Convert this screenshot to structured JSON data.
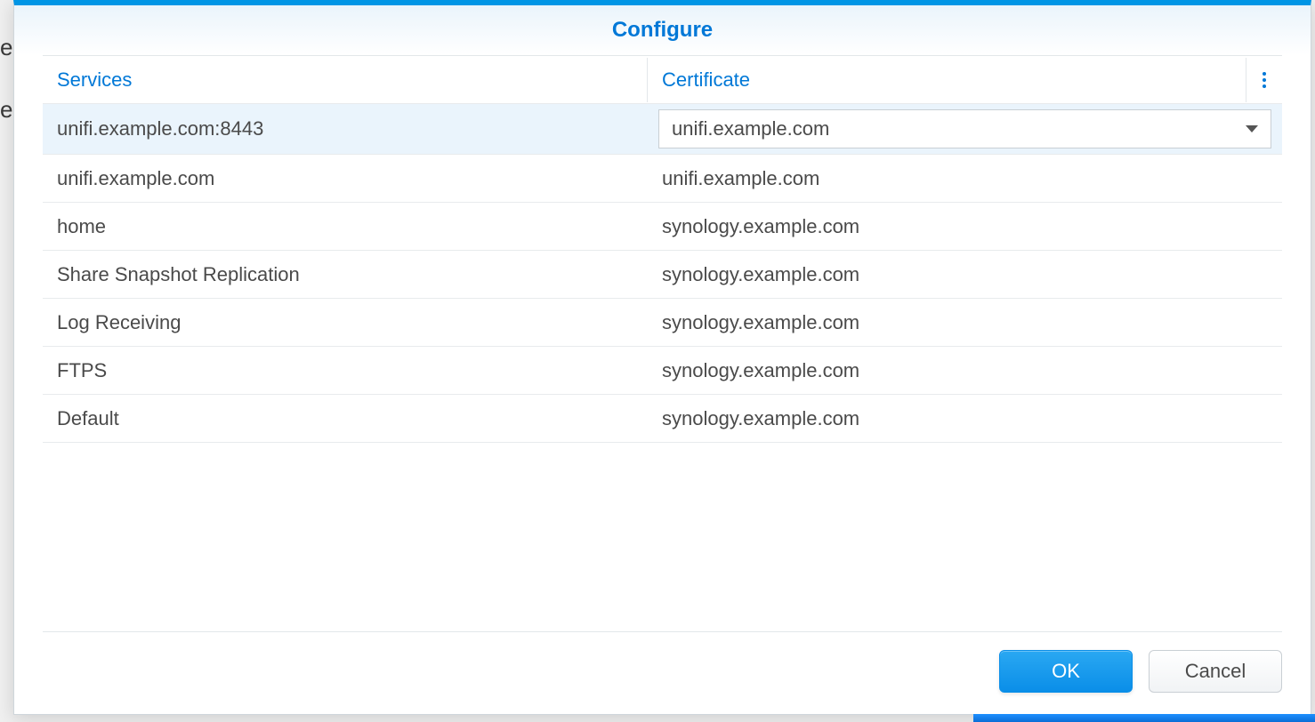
{
  "header": {
    "title": "Configure"
  },
  "grid": {
    "columns": [
      "Services",
      "Certificate"
    ],
    "rows": [
      {
        "service": "unifi.example.com:8443",
        "certificate": "unifi.example.com",
        "selected": true
      },
      {
        "service": "unifi.example.com",
        "certificate": "unifi.example.com"
      },
      {
        "service": "home",
        "certificate": "synology.example.com"
      },
      {
        "service": "Share Snapshot Replication",
        "certificate": "synology.example.com"
      },
      {
        "service": "Log Receiving",
        "certificate": "synology.example.com"
      },
      {
        "service": "FTPS",
        "certificate": "synology.example.com"
      },
      {
        "service": "Default",
        "certificate": "synology.example.com"
      }
    ]
  },
  "footer": {
    "ok_label": "OK",
    "cancel_label": "Cancel"
  }
}
